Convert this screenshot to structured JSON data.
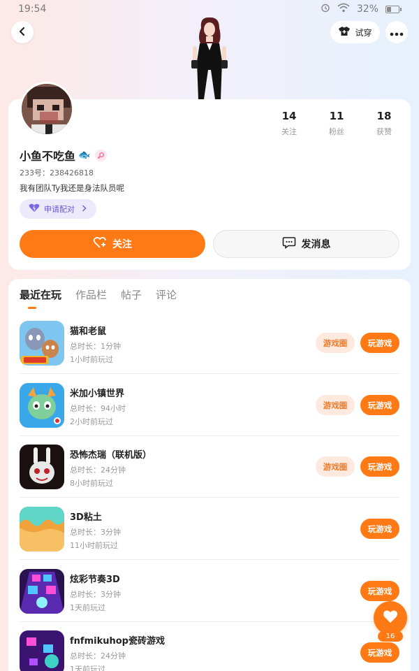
{
  "status_bar": {
    "time": "19:54",
    "battery": "32%",
    "battery_level": 0.32
  },
  "header": {
    "tryon_label": "试穿"
  },
  "profile": {
    "username": "小鱼不吃鱼",
    "username_emoji": "🐟",
    "id_text": "233号：238426818",
    "bio": "我有团队Ty我还是身法队员呢",
    "pair_label": "申请配对",
    "stats": [
      {
        "value": "14",
        "label": "关注"
      },
      {
        "value": "11",
        "label": "粉丝"
      },
      {
        "value": "18",
        "label": "获赞"
      }
    ],
    "follow_label": "关注",
    "message_label": "发消息"
  },
  "tabs": [
    "最近在玩",
    "作品栏",
    "帖子",
    "评论"
  ],
  "games": [
    {
      "name": "猫和老鼠",
      "duration": "总时长：1分钟",
      "last_played": "1小时前玩过",
      "circle_label": "游戏圈",
      "play_label": "玩游戏"
    },
    {
      "name": "米加小镇世界",
      "duration": "总时长：94小时",
      "last_played": "2小时前玩过",
      "circle_label": "游戏圈",
      "play_label": "玩游戏"
    },
    {
      "name": "恐怖杰瑞（联机版）",
      "duration": "总时长：24分钟",
      "last_played": "8小时前玩过",
      "circle_label": "游戏圈",
      "play_label": "玩游戏"
    },
    {
      "name": "3D粘土",
      "duration": "总时长：3分钟",
      "last_played": "11小时前玩过",
      "play_label": "玩游戏"
    },
    {
      "name": "炫彩节奏3D",
      "duration": "总时长：3分钟",
      "last_played": "1天前玩过",
      "play_label": "玩游戏"
    },
    {
      "name": "fnfmikuhop瓷砖游戏",
      "duration": "总时长：24分钟",
      "last_played": "1天前玩过",
      "play_label": "玩游戏"
    }
  ],
  "like_count": "16",
  "colors": {
    "accent": "#ff7a14",
    "pair_text": "#6a5bd0",
    "circle_bg": "#fde9dd"
  }
}
